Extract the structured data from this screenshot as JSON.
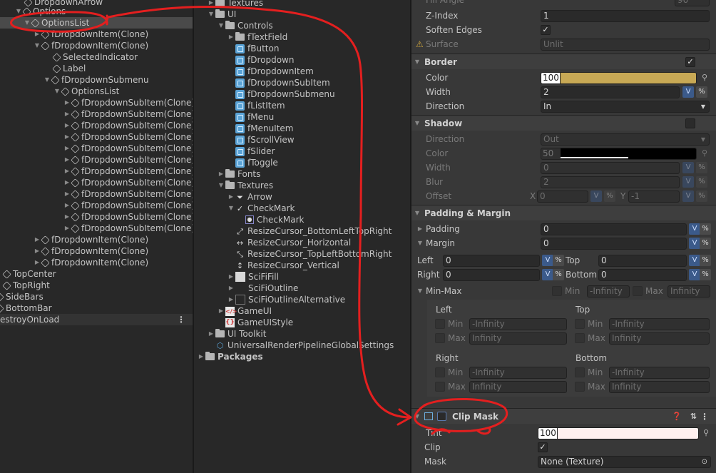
{
  "hierarchy": {
    "items": [
      {
        "label": "DropdownArrow"
      },
      {
        "label": "Options"
      },
      {
        "label": "OptionsList"
      },
      {
        "label": "fDropdownItem(Clone)"
      },
      {
        "label": "fDropdownItem(Clone)"
      },
      {
        "label": "SelectedIndicator"
      },
      {
        "label": "Label"
      },
      {
        "label": "fDropdownSubmenu"
      },
      {
        "label": "OptionsList"
      },
      {
        "label": "fDropdownSubItem(Clone)"
      },
      {
        "label": "fDropdownSubItem(Clone)"
      },
      {
        "label": "fDropdownSubItem(Clone)"
      },
      {
        "label": "fDropdownSubItem(Clone)"
      },
      {
        "label": "fDropdownSubItem(Clone)"
      },
      {
        "label": "fDropdownSubItem(Clone)"
      },
      {
        "label": "fDropdownSubItem(Clone)"
      },
      {
        "label": "fDropdownSubItem(Clone)"
      },
      {
        "label": "fDropdownSubItem(Clone)"
      },
      {
        "label": "fDropdownSubItem(Clone)"
      },
      {
        "label": "fDropdownSubItem(Clone)"
      },
      {
        "label": "fDropdownSubItem(Clone)"
      },
      {
        "label": "fDropdownItem(Clone)"
      },
      {
        "label": "fDropdownItem(Clone)"
      },
      {
        "label": "fDropdownItem(Clone)"
      },
      {
        "label": "TopCenter"
      },
      {
        "label": "TopRight"
      },
      {
        "label": "SideBars"
      },
      {
        "label": "BottomBar"
      },
      {
        "label": "estroyOnLoad"
      }
    ],
    "more_icon": "kebab-menu-icon"
  },
  "project": {
    "items": [
      {
        "label": "Textures"
      },
      {
        "label": "UI"
      },
      {
        "label": "Controls"
      },
      {
        "label": "fTextField"
      },
      {
        "label": "fButton"
      },
      {
        "label": "fDropdown"
      },
      {
        "label": "fDropdownItem"
      },
      {
        "label": "fDropdownSubItem"
      },
      {
        "label": "fDropdownSubmenu"
      },
      {
        "label": "fListItem"
      },
      {
        "label": "fMenu"
      },
      {
        "label": "fMenuItem"
      },
      {
        "label": "fScrollView"
      },
      {
        "label": "fSlider"
      },
      {
        "label": "fToggle"
      },
      {
        "label": "Fonts"
      },
      {
        "label": "Textures"
      },
      {
        "label": "Arrow"
      },
      {
        "label": "CheckMark"
      },
      {
        "label": "CheckMark"
      },
      {
        "label": "ResizeCursor_BottomLeftTopRight"
      },
      {
        "label": "ResizeCursor_Horizontal"
      },
      {
        "label": "ResizeCursor_TopLeftBottomRight"
      },
      {
        "label": "ResizeCursor_Vertical"
      },
      {
        "label": "SciFiFill"
      },
      {
        "label": "SciFiOutline"
      },
      {
        "label": "SciFiOutlineAlternative"
      },
      {
        "label": "GameUI"
      },
      {
        "label": "GameUIStyle"
      },
      {
        "label": "UI Toolkit"
      },
      {
        "label": "UniversalRenderPipelineGlobalSettings"
      },
      {
        "label": "Packages"
      }
    ]
  },
  "inspector": {
    "fill_angle": {
      "label": "Fill Angle",
      "value": "90"
    },
    "z_index": {
      "label": "Z-Index",
      "value": "1"
    },
    "soften_edges": {
      "label": "Soften Edges",
      "checked": true,
      "check": "✓"
    },
    "surface": {
      "label": "Surface",
      "value": "Unlit"
    },
    "border": {
      "title": "Border",
      "enabled": true,
      "check": "✓",
      "color_label": "Color",
      "color_alpha": "100",
      "color_hex": "#c8a955",
      "width_label": "Width",
      "width_value": "2",
      "direction_label": "Direction",
      "direction_value": "In"
    },
    "shadow": {
      "title": "Shadow",
      "enabled": false,
      "direction_label": "Direction",
      "direction_value": "Out",
      "color_label": "Color",
      "color_alpha": "50",
      "color_hex": "#000000",
      "width_label": "Width",
      "width_value": "0",
      "blur_label": "Blur",
      "blur_value": "2",
      "offset_label": "Offset",
      "offset_x_label": "X",
      "offset_x": "0",
      "offset_y_label": "Y",
      "offset_y": "-1"
    },
    "padding_margin": {
      "title": "Padding & Margin",
      "padding_label": "Padding",
      "padding_value": "0",
      "margin_label": "Margin",
      "margin_value": "0",
      "left_label": "Left",
      "left_value": "0",
      "top_label": "Top",
      "top_value": "0",
      "right_label": "Right",
      "right_value": "0",
      "bottom_label": "Bottom",
      "bottom_value": "0"
    },
    "minmax": {
      "title": "Min-Max",
      "min_label": "Min",
      "max_label": "Max",
      "min_placeholder": "-Infinity",
      "max_placeholder": "Infinity",
      "groups": [
        {
          "title": "Left"
        },
        {
          "title": "Top"
        },
        {
          "title": "Right"
        },
        {
          "title": "Bottom"
        }
      ]
    },
    "clip_mask": {
      "title": "Clip Mask",
      "tint_label": "Tint",
      "tint_alpha": "100",
      "tint_hex": "#fff0ef",
      "clip_label": "Clip",
      "clip_checked": true,
      "check": "✓",
      "mask_label": "Mask",
      "mask_value": "None (Texture)"
    },
    "units": {
      "v": "V",
      "pct": "%"
    },
    "colors": {
      "accent_blue": "#3b5a8a",
      "annotation_red": "#e41f1f"
    }
  }
}
